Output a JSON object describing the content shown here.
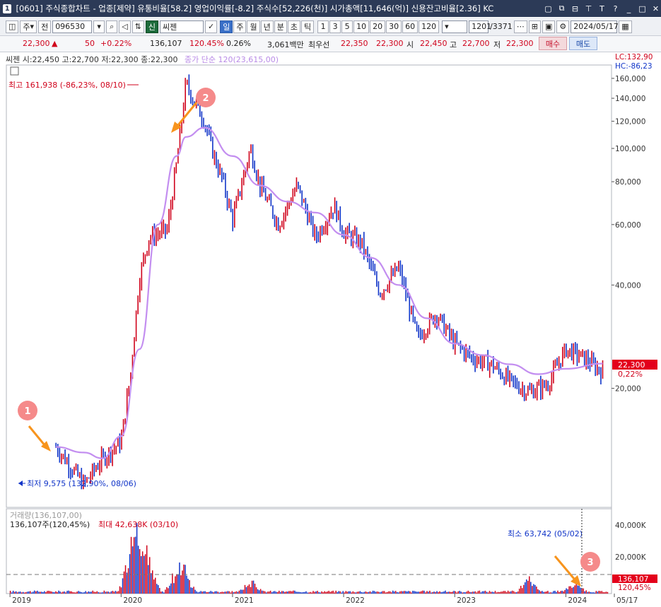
{
  "window": {
    "number": "1",
    "title": "[0601] 주식종합차트 - 업종[제약] 유통비율[58.2] 영업이익률[-8.2] 주식수[52,226(천)] 시가총액[11,646(억)] 신용잔고비율[2.36] KC"
  },
  "toolbar": {
    "period_type": "주",
    "market": "전",
    "code": "096530",
    "credit_badge": "신",
    "stock_name": "씨젠",
    "periods": [
      "일",
      "주",
      "월",
      "년",
      "분",
      "초",
      "틱"
    ],
    "active_period": "일",
    "intervals": [
      "1",
      "3",
      "5",
      "10",
      "20",
      "30",
      "60",
      "120"
    ],
    "count": "1201",
    "total": "/3371",
    "date": "2024/05/17"
  },
  "quote": {
    "price": "22,300",
    "arrow": "▲",
    "change": "50",
    "change_pct": "+0.22%",
    "volume": "136,107",
    "volume_pct": "120.45%",
    "turnover": "0.26%",
    "amount": "3,061백만",
    "best_label": "최우선",
    "best_ask": "22,350",
    "best_bid": "22,300",
    "open_label": "시",
    "open": "22,450",
    "high_label": "고",
    "high": "22,700",
    "low_label": "저",
    "low": "22,300",
    "buy": "매수",
    "sell": "매도"
  },
  "chart_info": {
    "ohlc": "씨젠 시:22,450 고:22,700 저:22,300 종:22,300",
    "sma": "종가 단순 120(23,615,00)",
    "lc": "LC:132,90",
    "hc": "HC:-86,23",
    "max_label": "최고 161,938 (-86,23%, 08/10)",
    "min_label": "최저 9,575 (132,90%, 08/06)",
    "current_price": "22,300",
    "current_pct": "0,22%"
  },
  "volume_info": {
    "title": "거래량(136,107,00)",
    "current": "136,107주(120,45%)",
    "max_label": "최대 42,638K (03/10)",
    "min_label": "최소 63,742 (05/02)",
    "current_box": "136,107",
    "current_pct": "120,45%"
  },
  "annotations": [
    "1",
    "2",
    "3"
  ],
  "colors": {
    "up": "#d0021b",
    "down": "#1034c8",
    "sma": "#c38ef0",
    "annotation": "#f58a8a",
    "arrow": "#f7941d"
  },
  "chart_data": {
    "type": "line",
    "title": "",
    "xlabel": "",
    "ylabel": "",
    "scale": "log",
    "x_ticks": [
      "2019",
      "2020",
      "2021",
      "2022",
      "2023",
      "2024",
      "05/17"
    ],
    "y_ticks": [
      "160,000",
      "140,000",
      "120,000",
      "100,000",
      "80,000",
      "60,000",
      "40,000",
      "20,000"
    ],
    "ylim": [
      9000,
      175000
    ],
    "price_path": {
      "x": [
        "2019-06",
        "2019-09",
        "2019-11",
        "2020-01",
        "2020-02",
        "2020-03",
        "2020-04",
        "2020-06",
        "2020-07",
        "2020-08",
        "2020-09",
        "2020-10",
        "2020-11",
        "2020-12",
        "2021-01",
        "2021-03",
        "2021-04",
        "2021-06",
        "2021-08",
        "2021-10",
        "2021-12",
        "2022-01",
        "2022-03",
        "2022-05",
        "2022-07",
        "2022-09",
        "2022-11",
        "2023-01",
        "2023-03",
        "2023-05",
        "2023-07",
        "2023-09",
        "2023-11",
        "2024-01",
        "2024-03",
        "2024-05"
      ],
      "y": [
        13500,
        10500,
        12500,
        14000,
        22000,
        42000,
        55000,
        58000,
        90000,
        155000,
        135000,
        120000,
        95000,
        80000,
        62000,
        100000,
        78000,
        60000,
        78000,
        55000,
        68000,
        57000,
        53000,
        38000,
        45000,
        28000,
        33000,
        27000,
        24500,
        23500,
        21000,
        19500,
        20500,
        26000,
        24500,
        22300
      ]
    },
    "sma_120": {
      "name": "",
      "x": [
        "2019-06",
        "2019-09",
        "2019-11",
        "2020-01",
        "2020-03",
        "2020-05",
        "2020-07",
        "2020-08",
        "2020-10",
        "2021-01",
        "2021-04",
        "2021-07",
        "2021-10",
        "2022-01",
        "2022-04",
        "2022-07",
        "2022-10",
        "2023-01",
        "2023-04",
        "2023-07",
        "2023-10",
        "2024-01",
        "2024-05"
      ],
      "y": [
        13500,
        13000,
        12500,
        14500,
        26000,
        60000,
        95000,
        108000,
        115000,
        95000,
        78000,
        70000,
        65000,
        56000,
        48000,
        40000,
        32000,
        27000,
        25000,
        23500,
        22000,
        22800,
        23615
      ]
    },
    "volume": {
      "ylim": [
        0,
        50000
      ],
      "y_ticks": [
        "40,000K",
        "20,000K"
      ],
      "peaks": [
        {
          "x": "2020-03",
          "value": 42638
        },
        {
          "x": "2020-02",
          "value": 30000
        },
        {
          "x": "2020-04",
          "value": 24000
        },
        {
          "x": "2020-07",
          "value": 18000
        },
        {
          "x": "2020-08",
          "value": 12000
        },
        {
          "x": "2021-03",
          "value": 8000
        },
        {
          "x": "2023-09",
          "value": 9000
        },
        {
          "x": "2024-02",
          "value": 7000
        }
      ]
    }
  }
}
